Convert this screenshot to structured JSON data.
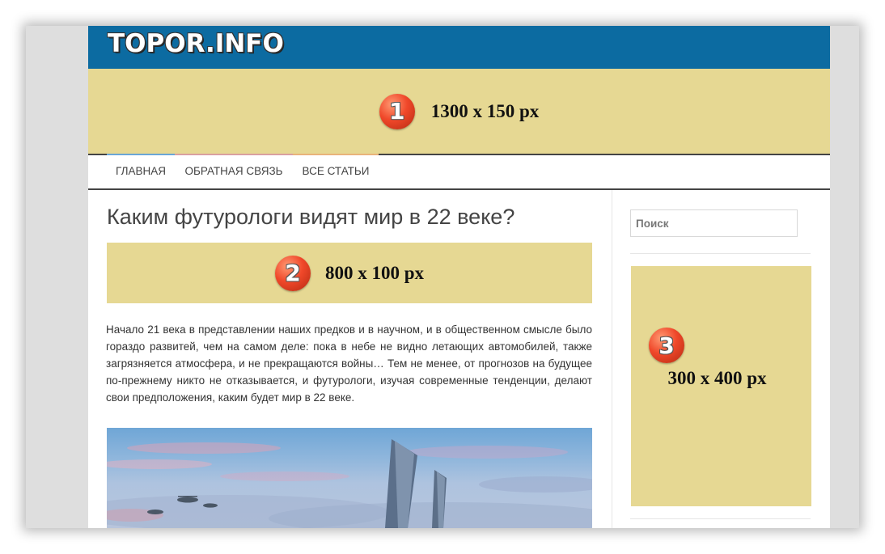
{
  "site": {
    "logo": "TOPOR.INFO"
  },
  "banner_top": {
    "number": "1",
    "size": "1300 x 150 px"
  },
  "nav": {
    "items": [
      {
        "label": "ГЛАВНАЯ",
        "accent": "#6aa6d6"
      },
      {
        "label": "ОБРАТНАЯ СВЯЗЬ",
        "accent": "#d9a0a0"
      },
      {
        "label": "ВСЕ СТАТЬИ",
        "accent": "#e8b37a"
      }
    ]
  },
  "article": {
    "title": "Каким футурологи видят мир в 22 веке?",
    "ad": {
      "number": "2",
      "size": "800 x 100 px"
    },
    "intro": "Начало 21 века в представлении наших предков и в научном, и в общественном смысле было гораздо развитей, чем на самом деле: пока в небе не видно летающих автомобилей, также загрязняется атмосфера, и не прекращаются войны… Тем не менее, от прогнозов на будущее по-прежнему никто не отказывается, и футурологи, изучая современные тенденции, делают свои предположения, каким будет мир в 22 веке."
  },
  "sidebar": {
    "search": {
      "placeholder": "Поиск"
    },
    "ad": {
      "number": "3",
      "size": "300 x 400 px"
    }
  },
  "colors": {
    "header": "#0c6ba1",
    "ad_placeholder": "#e6d893",
    "badge": "#f0482a"
  }
}
